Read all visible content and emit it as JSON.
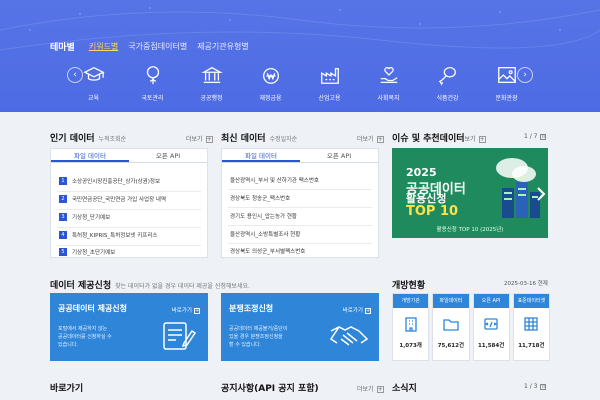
{
  "hero": {
    "tabs": [
      "테마별",
      "키워드별",
      "국가중점데이터별",
      "제공기관유형별"
    ],
    "categories": [
      {
        "label": "교육",
        "icon": "graduation-cap-icon"
      },
      {
        "label": "국토관리",
        "icon": "tree-icon"
      },
      {
        "label": "공공행정",
        "icon": "government-building-icon"
      },
      {
        "label": "재정금융",
        "icon": "money-bag-icon"
      },
      {
        "label": "산업고용",
        "icon": "factory-icon"
      },
      {
        "label": "사회복지",
        "icon": "heart-hand-icon"
      },
      {
        "label": "식품건강",
        "icon": "drumstick-icon"
      },
      {
        "label": "문화관광",
        "icon": "picture-icon"
      }
    ],
    "prev": "‹",
    "next": "›"
  },
  "popular": {
    "title": "인기 데이터",
    "subtitle": "누적조회순",
    "more": "더보기",
    "tabs": [
      "파일 데이터",
      "오픈 API"
    ],
    "items": [
      {
        "n": "1",
        "text": "소상공인시장진흥공단_상가(상권)정보"
      },
      {
        "n": "2",
        "text": "국민연금공단_국민연금 가입 사업장 내역"
      },
      {
        "n": "3",
        "text": "기상청_단기예보"
      },
      {
        "n": "4",
        "text": "특허청_KIPRIS_특허정보넷 키프리스"
      },
      {
        "n": "5",
        "text": "기상청_초단기예보"
      }
    ]
  },
  "recent": {
    "title": "최신 데이터",
    "subtitle": "수정일자순",
    "more": "더보기",
    "tabs": [
      "파일 데이터",
      "오픈 API"
    ],
    "items": [
      "울산광역시_부서 및 산하기관 팩스번호",
      "경상북도 청송군_팩스번호",
      "경기도 용인시_압는농가 현황",
      "울산광역시_소방특별조사 현황",
      "경상북도 의성군_부서별팩스번호"
    ]
  },
  "issue": {
    "title": "이슈 및 추천데이터",
    "more": "더보기",
    "pager": "1 / 7",
    "banner_line1": "2025",
    "banner_line2": "공공데이터",
    "banner_line3": "활용신청",
    "banner_line4": "TOP 10",
    "banner_caption": "활용신청 TOP 10 (2025년)"
  },
  "request": {
    "title": "데이터 제공신청",
    "subtitle": "찾는 데이터가 없을 경우 데이터 제공을 신청해보세요.",
    "cards": [
      {
        "title": "공공데이터 제공신청",
        "more": "바로가기",
        "desc1": "포털에서 제공하지 않는",
        "desc2": "공공데이터를 신청하실 수",
        "desc3": "있습니다."
      },
      {
        "title": "분쟁조정신청",
        "more": "바로가기",
        "desc1": "공공데이터 제공불거/중단이",
        "desc2": "있을 경우 분쟁조정신청을",
        "desc3": "할 수 있습니다."
      }
    ]
  },
  "status": {
    "title": "개방현황",
    "date": "2025-03-16 현재",
    "items": [
      {
        "label": "개방기관",
        "value": "1,073개",
        "icon": "building-icon"
      },
      {
        "label": "파일데이터",
        "value": "75,612건",
        "icon": "folder-icon"
      },
      {
        "label": "오픈 API",
        "value": "11,584건",
        "icon": "api-icon"
      },
      {
        "label": "표준데이터셋",
        "value": "11,718건",
        "icon": "grid-icon"
      }
    ]
  },
  "bottom": {
    "shortcut": "바로가기",
    "notice": "공지사항(API 공지 포함)",
    "notice_more": "더보기",
    "news": "소식지",
    "news_pager": "1 / 3"
  }
}
